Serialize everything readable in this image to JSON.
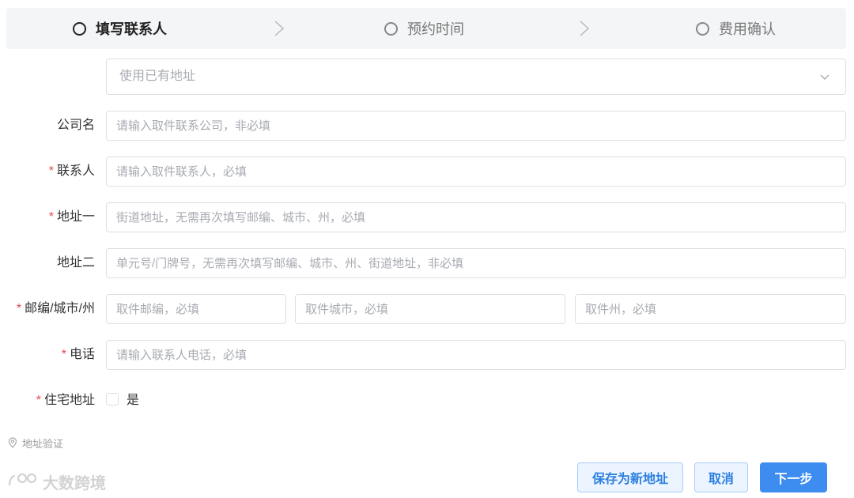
{
  "steps": [
    {
      "label": "填写联系人",
      "active": true
    },
    {
      "label": "预约时间",
      "active": false
    },
    {
      "label": "费用确认",
      "active": false
    }
  ],
  "address_select": {
    "placeholder": "使用已有地址"
  },
  "form": {
    "company": {
      "label": "公司名",
      "required": false,
      "placeholder": "请输入取件联系公司，非必填"
    },
    "contact": {
      "label": "联系人",
      "required": true,
      "placeholder": "请输入取件联系人，必填"
    },
    "address1": {
      "label": "地址一",
      "required": true,
      "placeholder": "街道地址，无需再次填写邮编、城市、州，必填"
    },
    "address2": {
      "label": "地址二",
      "required": false,
      "placeholder": "单元号/门牌号，无需再次填写邮编、城市、州、街道地址，非必填"
    },
    "zip_city_state": {
      "label": "邮编/城市/州",
      "required": true,
      "zip_placeholder": "取件邮编，必填",
      "city_placeholder": "取件城市，必填",
      "state_placeholder": "取件州，必填"
    },
    "phone": {
      "label": "电话",
      "required": true,
      "placeholder": "请输入联系人电话，必填"
    },
    "residential": {
      "label": "住宅地址",
      "required": true,
      "option_label": "是",
      "checked": false
    }
  },
  "verify_link": {
    "label": "地址验证",
    "icon": "location-pin-icon"
  },
  "watermark": {
    "text": "大数跨境"
  },
  "buttons": {
    "save_new": "保存为新地址",
    "cancel": "取消",
    "next": "下一步"
  },
  "colors": {
    "primary": "#3d8cf0",
    "required": "#e5484d",
    "border": "#dcdfe6",
    "placeholder": "#a8abb2"
  }
}
